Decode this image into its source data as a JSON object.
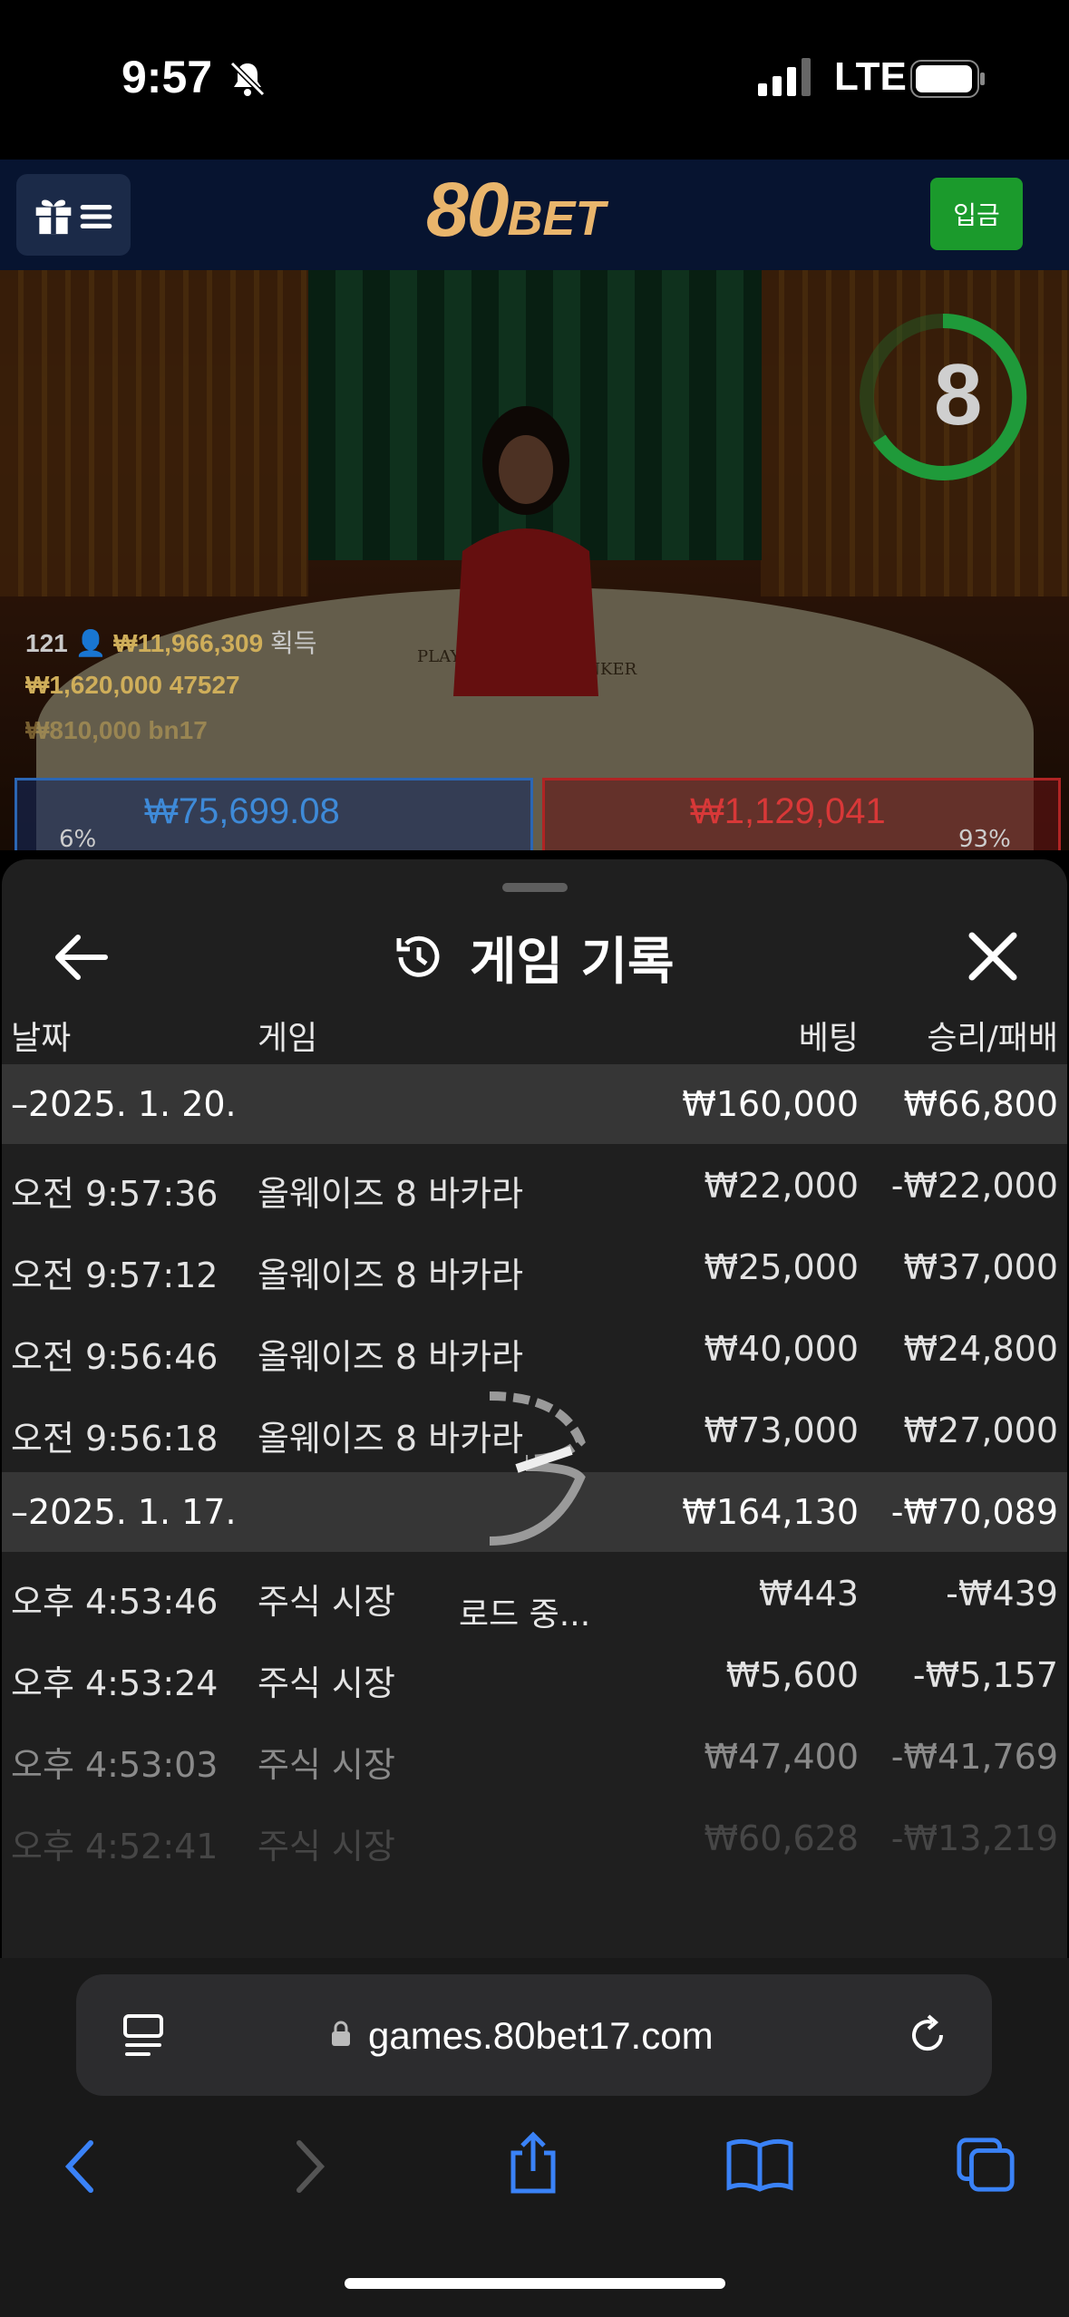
{
  "status_bar": {
    "time": "9:57",
    "carrier": "LTE"
  },
  "header": {
    "logo_main": "80",
    "logo_sub": "BET",
    "deposit_label": "입금"
  },
  "video": {
    "timer_value": "8",
    "stat1_players": "121",
    "stat1_amount": "₩11,966,309",
    "stat1_suffix": "획득",
    "stat2": "₩1,620,000  47527",
    "stat3": "₩810,000  bn17",
    "left_bet_pct": "6%",
    "left_bet_amount": "₩75,699.08",
    "right_bet_amount": "₩1,129,041",
    "right_bet_pct": "93%",
    "table_label_player": "PLAYER",
    "table_label_banker": "BANKER"
  },
  "sheet": {
    "title": "게임 기록",
    "columns": {
      "date": "날짜",
      "game": "게임",
      "bet": "베팅",
      "result": "승리/패배"
    },
    "groups": [
      {
        "date": "–2025. 1. 20.",
        "bet": "₩160,000",
        "result": "₩66,800",
        "rows": [
          {
            "time": "오전 9:57:36",
            "game": "올웨이즈 8 바카라",
            "bet": "₩22,000",
            "result": "-₩22,000"
          },
          {
            "time": "오전 9:57:12",
            "game": "올웨이즈 8 바카라",
            "bet": "₩25,000",
            "result": "₩37,000"
          },
          {
            "time": "오전 9:56:46",
            "game": "올웨이즈 8 바카라",
            "bet": "₩40,000",
            "result": "₩24,800"
          },
          {
            "time": "오전 9:56:18",
            "game": "올웨이즈 8 바카라",
            "bet": "₩73,000",
            "result": "₩27,000"
          }
        ]
      },
      {
        "date": "–2025. 1. 17.",
        "bet": "₩164,130",
        "result": "-₩70,089",
        "rows": [
          {
            "time": "오후 4:53:46",
            "game": "주식 시장",
            "bet": "₩443",
            "result": "-₩439"
          },
          {
            "time": "오후 4:53:24",
            "game": "주식 시장",
            "bet": "₩5,600",
            "result": "-₩5,157"
          },
          {
            "time": "오후 4:53:03",
            "game": "주식 시장",
            "bet": "₩47,400",
            "result": "-₩41,769"
          },
          {
            "time": "오후 4:52:41",
            "game": "주식 시장",
            "bet": "₩60,628",
            "result": "-₩13,219"
          }
        ]
      }
    ],
    "loading_text": "로드 중..."
  },
  "browser": {
    "url": "games.80bet17.com"
  },
  "colors": {
    "deposit": "#1b9a2c",
    "logo": "#e9b56c",
    "safari_blue": "#3a82f7"
  }
}
